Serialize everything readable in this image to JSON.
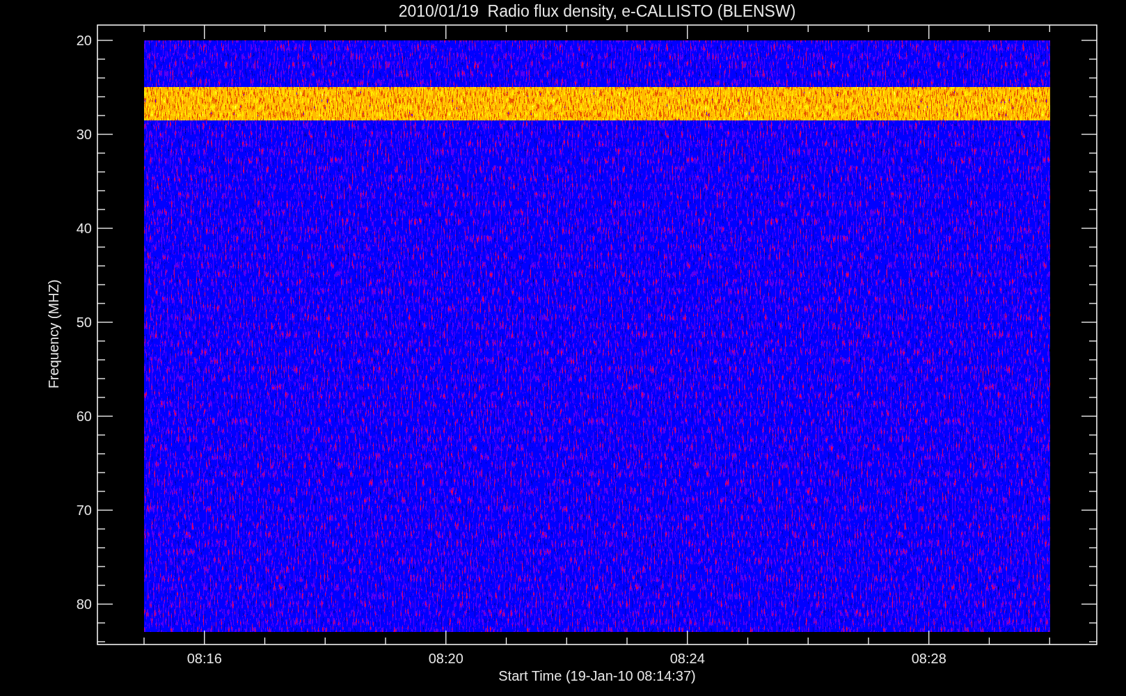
{
  "title": "2010/01/19  Radio flux density, e-CALLISTO (BLENSW)",
  "y_axis": {
    "label": "Frequency (MHZ)",
    "ticks": [
      "20",
      "30",
      "40",
      "50",
      "60",
      "70",
      "80"
    ]
  },
  "x_axis": {
    "label": "Start Time (19-Jan-10 08:14:37)",
    "ticks": [
      "08:16",
      "08:20",
      "08:24",
      "08:28"
    ]
  }
}
